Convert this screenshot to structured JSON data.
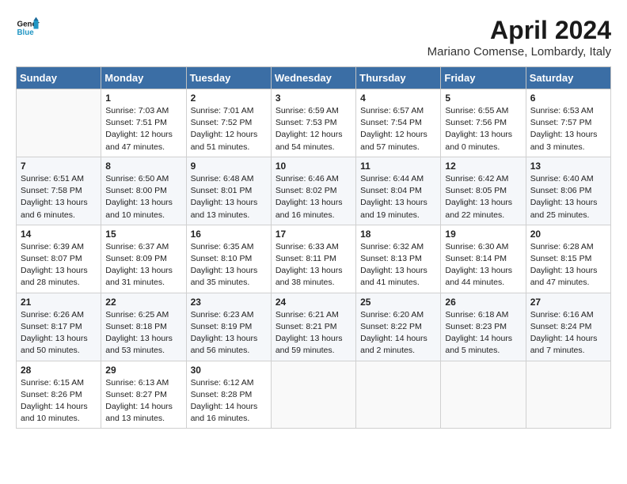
{
  "header": {
    "logo_line1": "General",
    "logo_line2": "Blue",
    "month_year": "April 2024",
    "location": "Mariano Comense, Lombardy, Italy"
  },
  "columns": [
    "Sunday",
    "Monday",
    "Tuesday",
    "Wednesday",
    "Thursday",
    "Friday",
    "Saturday"
  ],
  "weeks": [
    [
      {
        "day": "",
        "sunrise": "",
        "sunset": "",
        "daylight": ""
      },
      {
        "day": "1",
        "sunrise": "Sunrise: 7:03 AM",
        "sunset": "Sunset: 7:51 PM",
        "daylight": "Daylight: 12 hours and 47 minutes."
      },
      {
        "day": "2",
        "sunrise": "Sunrise: 7:01 AM",
        "sunset": "Sunset: 7:52 PM",
        "daylight": "Daylight: 12 hours and 51 minutes."
      },
      {
        "day": "3",
        "sunrise": "Sunrise: 6:59 AM",
        "sunset": "Sunset: 7:53 PM",
        "daylight": "Daylight: 12 hours and 54 minutes."
      },
      {
        "day": "4",
        "sunrise": "Sunrise: 6:57 AM",
        "sunset": "Sunset: 7:54 PM",
        "daylight": "Daylight: 12 hours and 57 minutes."
      },
      {
        "day": "5",
        "sunrise": "Sunrise: 6:55 AM",
        "sunset": "Sunset: 7:56 PM",
        "daylight": "Daylight: 13 hours and 0 minutes."
      },
      {
        "day": "6",
        "sunrise": "Sunrise: 6:53 AM",
        "sunset": "Sunset: 7:57 PM",
        "daylight": "Daylight: 13 hours and 3 minutes."
      }
    ],
    [
      {
        "day": "7",
        "sunrise": "Sunrise: 6:51 AM",
        "sunset": "Sunset: 7:58 PM",
        "daylight": "Daylight: 13 hours and 6 minutes."
      },
      {
        "day": "8",
        "sunrise": "Sunrise: 6:50 AM",
        "sunset": "Sunset: 8:00 PM",
        "daylight": "Daylight: 13 hours and 10 minutes."
      },
      {
        "day": "9",
        "sunrise": "Sunrise: 6:48 AM",
        "sunset": "Sunset: 8:01 PM",
        "daylight": "Daylight: 13 hours and 13 minutes."
      },
      {
        "day": "10",
        "sunrise": "Sunrise: 6:46 AM",
        "sunset": "Sunset: 8:02 PM",
        "daylight": "Daylight: 13 hours and 16 minutes."
      },
      {
        "day": "11",
        "sunrise": "Sunrise: 6:44 AM",
        "sunset": "Sunset: 8:04 PM",
        "daylight": "Daylight: 13 hours and 19 minutes."
      },
      {
        "day": "12",
        "sunrise": "Sunrise: 6:42 AM",
        "sunset": "Sunset: 8:05 PM",
        "daylight": "Daylight: 13 hours and 22 minutes."
      },
      {
        "day": "13",
        "sunrise": "Sunrise: 6:40 AM",
        "sunset": "Sunset: 8:06 PM",
        "daylight": "Daylight: 13 hours and 25 minutes."
      }
    ],
    [
      {
        "day": "14",
        "sunrise": "Sunrise: 6:39 AM",
        "sunset": "Sunset: 8:07 PM",
        "daylight": "Daylight: 13 hours and 28 minutes."
      },
      {
        "day": "15",
        "sunrise": "Sunrise: 6:37 AM",
        "sunset": "Sunset: 8:09 PM",
        "daylight": "Daylight: 13 hours and 31 minutes."
      },
      {
        "day": "16",
        "sunrise": "Sunrise: 6:35 AM",
        "sunset": "Sunset: 8:10 PM",
        "daylight": "Daylight: 13 hours and 35 minutes."
      },
      {
        "day": "17",
        "sunrise": "Sunrise: 6:33 AM",
        "sunset": "Sunset: 8:11 PM",
        "daylight": "Daylight: 13 hours and 38 minutes."
      },
      {
        "day": "18",
        "sunrise": "Sunrise: 6:32 AM",
        "sunset": "Sunset: 8:13 PM",
        "daylight": "Daylight: 13 hours and 41 minutes."
      },
      {
        "day": "19",
        "sunrise": "Sunrise: 6:30 AM",
        "sunset": "Sunset: 8:14 PM",
        "daylight": "Daylight: 13 hours and 44 minutes."
      },
      {
        "day": "20",
        "sunrise": "Sunrise: 6:28 AM",
        "sunset": "Sunset: 8:15 PM",
        "daylight": "Daylight: 13 hours and 47 minutes."
      }
    ],
    [
      {
        "day": "21",
        "sunrise": "Sunrise: 6:26 AM",
        "sunset": "Sunset: 8:17 PM",
        "daylight": "Daylight: 13 hours and 50 minutes."
      },
      {
        "day": "22",
        "sunrise": "Sunrise: 6:25 AM",
        "sunset": "Sunset: 8:18 PM",
        "daylight": "Daylight: 13 hours and 53 minutes."
      },
      {
        "day": "23",
        "sunrise": "Sunrise: 6:23 AM",
        "sunset": "Sunset: 8:19 PM",
        "daylight": "Daylight: 13 hours and 56 minutes."
      },
      {
        "day": "24",
        "sunrise": "Sunrise: 6:21 AM",
        "sunset": "Sunset: 8:21 PM",
        "daylight": "Daylight: 13 hours and 59 minutes."
      },
      {
        "day": "25",
        "sunrise": "Sunrise: 6:20 AM",
        "sunset": "Sunset: 8:22 PM",
        "daylight": "Daylight: 14 hours and 2 minutes."
      },
      {
        "day": "26",
        "sunrise": "Sunrise: 6:18 AM",
        "sunset": "Sunset: 8:23 PM",
        "daylight": "Daylight: 14 hours and 5 minutes."
      },
      {
        "day": "27",
        "sunrise": "Sunrise: 6:16 AM",
        "sunset": "Sunset: 8:24 PM",
        "daylight": "Daylight: 14 hours and 7 minutes."
      }
    ],
    [
      {
        "day": "28",
        "sunrise": "Sunrise: 6:15 AM",
        "sunset": "Sunset: 8:26 PM",
        "daylight": "Daylight: 14 hours and 10 minutes."
      },
      {
        "day": "29",
        "sunrise": "Sunrise: 6:13 AM",
        "sunset": "Sunset: 8:27 PM",
        "daylight": "Daylight: 14 hours and 13 minutes."
      },
      {
        "day": "30",
        "sunrise": "Sunrise: 6:12 AM",
        "sunset": "Sunset: 8:28 PM",
        "daylight": "Daylight: 14 hours and 16 minutes."
      },
      {
        "day": "",
        "sunrise": "",
        "sunset": "",
        "daylight": ""
      },
      {
        "day": "",
        "sunrise": "",
        "sunset": "",
        "daylight": ""
      },
      {
        "day": "",
        "sunrise": "",
        "sunset": "",
        "daylight": ""
      },
      {
        "day": "",
        "sunrise": "",
        "sunset": "",
        "daylight": ""
      }
    ]
  ]
}
